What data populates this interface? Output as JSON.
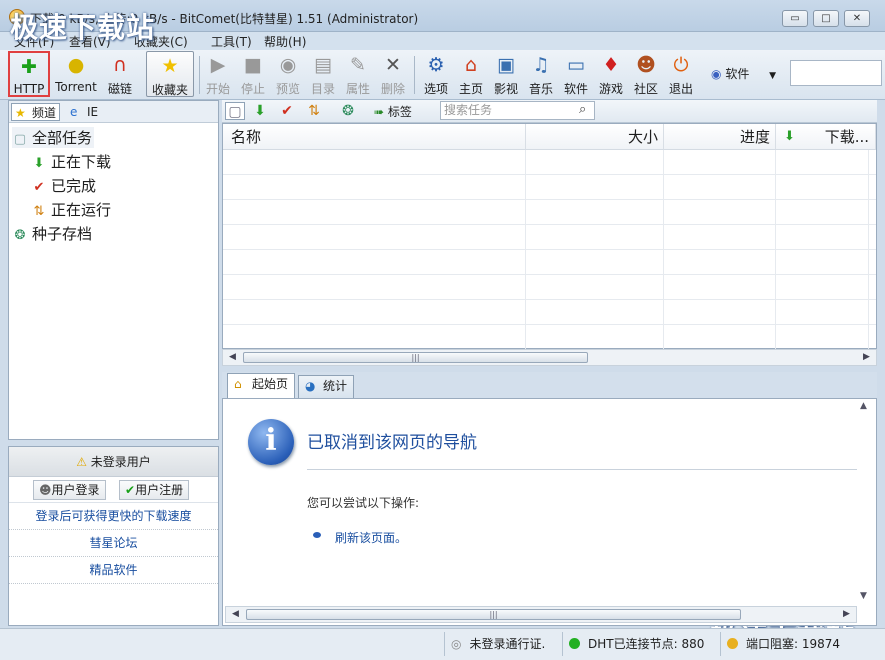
{
  "window": {
    "title": "下载:0 kB/s, 上传:0 kB/s - BitComet(比特彗星) 1.51 (Administrator)",
    "buttons": {
      "minimize": "▭",
      "maximize": "□",
      "close": "✕"
    }
  },
  "menu": [
    "文件(F)",
    "查看(V)",
    "收藏夹(C)",
    "工具(T)",
    "帮助(H)"
  ],
  "toolbar": {
    "http": "HTTP",
    "torrent": "Torrent",
    "magnet": "磁链",
    "favorites": "收藏夹",
    "start": "开始",
    "stop": "停止",
    "preview": "预览",
    "directory": "目录",
    "properties": "属性",
    "delete": "删除",
    "options": "选项",
    "home": "主页",
    "video": "影视",
    "music": "音乐",
    "software": "软件",
    "games": "游戏",
    "community": "社区",
    "exit": "退出",
    "software_dropdown": "软件"
  },
  "watermark": "极速下载站",
  "left_panel": {
    "tabs": {
      "channel": "频道",
      "ie": "IE"
    },
    "tree": {
      "all_tasks": "全部任务",
      "downloading": "正在下载",
      "completed": "已完成",
      "running": "正在运行",
      "torrent_archive": "种子存档"
    }
  },
  "account_panel": {
    "status": "未登录用户",
    "login_button": "用户登录",
    "register_button": "用户注册",
    "links": [
      "登录后可获得更快的下载速度",
      "彗星论坛",
      "精品软件"
    ]
  },
  "task_toolbar": {
    "tags_label": "标签",
    "search_placeholder": "搜索任务"
  },
  "task_table": {
    "headers": {
      "name": "名称",
      "size": "大小",
      "progress": "进度",
      "download_speed": "下载..."
    },
    "rows": []
  },
  "bottom_tabs": {
    "start_page": "起始页",
    "stats": "统计"
  },
  "browser_page": {
    "title": "已取消到该网页的导航",
    "subtitle": "您可以尝试以下操作:",
    "link": "刷新该页面。"
  },
  "status_bar": {
    "login": "未登录通行证.",
    "dht": "DHT已连接节点: 880",
    "port": "端口阻塞: 19874"
  },
  "colors": {
    "accent": "#1f4f9e",
    "highlight_box": "#e04040",
    "status_green": "#22b022"
  }
}
